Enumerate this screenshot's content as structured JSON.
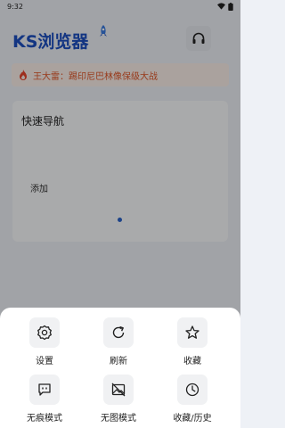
{
  "status_bar": {
    "time": "9:32"
  },
  "header": {
    "logo_text": "KS浏览器"
  },
  "news": {
    "text": "王大雷：踢印尼巴林像保级大战"
  },
  "quick_nav": {
    "title": "快速导航",
    "add_label": "添加"
  },
  "menu": {
    "items": [
      {
        "label": "设置",
        "icon": "gear-icon"
      },
      {
        "label": "刷新",
        "icon": "refresh-icon"
      },
      {
        "label": "收藏",
        "icon": "star-icon"
      },
      {
        "label": "无痕模式",
        "icon": "incognito-icon"
      },
      {
        "label": "无图模式",
        "icon": "no-image-icon"
      },
      {
        "label": "收藏/历史",
        "icon": "history-clock-icon"
      }
    ]
  },
  "colors": {
    "brand": "#1d4fc0",
    "news_text": "#e0572a",
    "dot": "#2a62c9"
  }
}
